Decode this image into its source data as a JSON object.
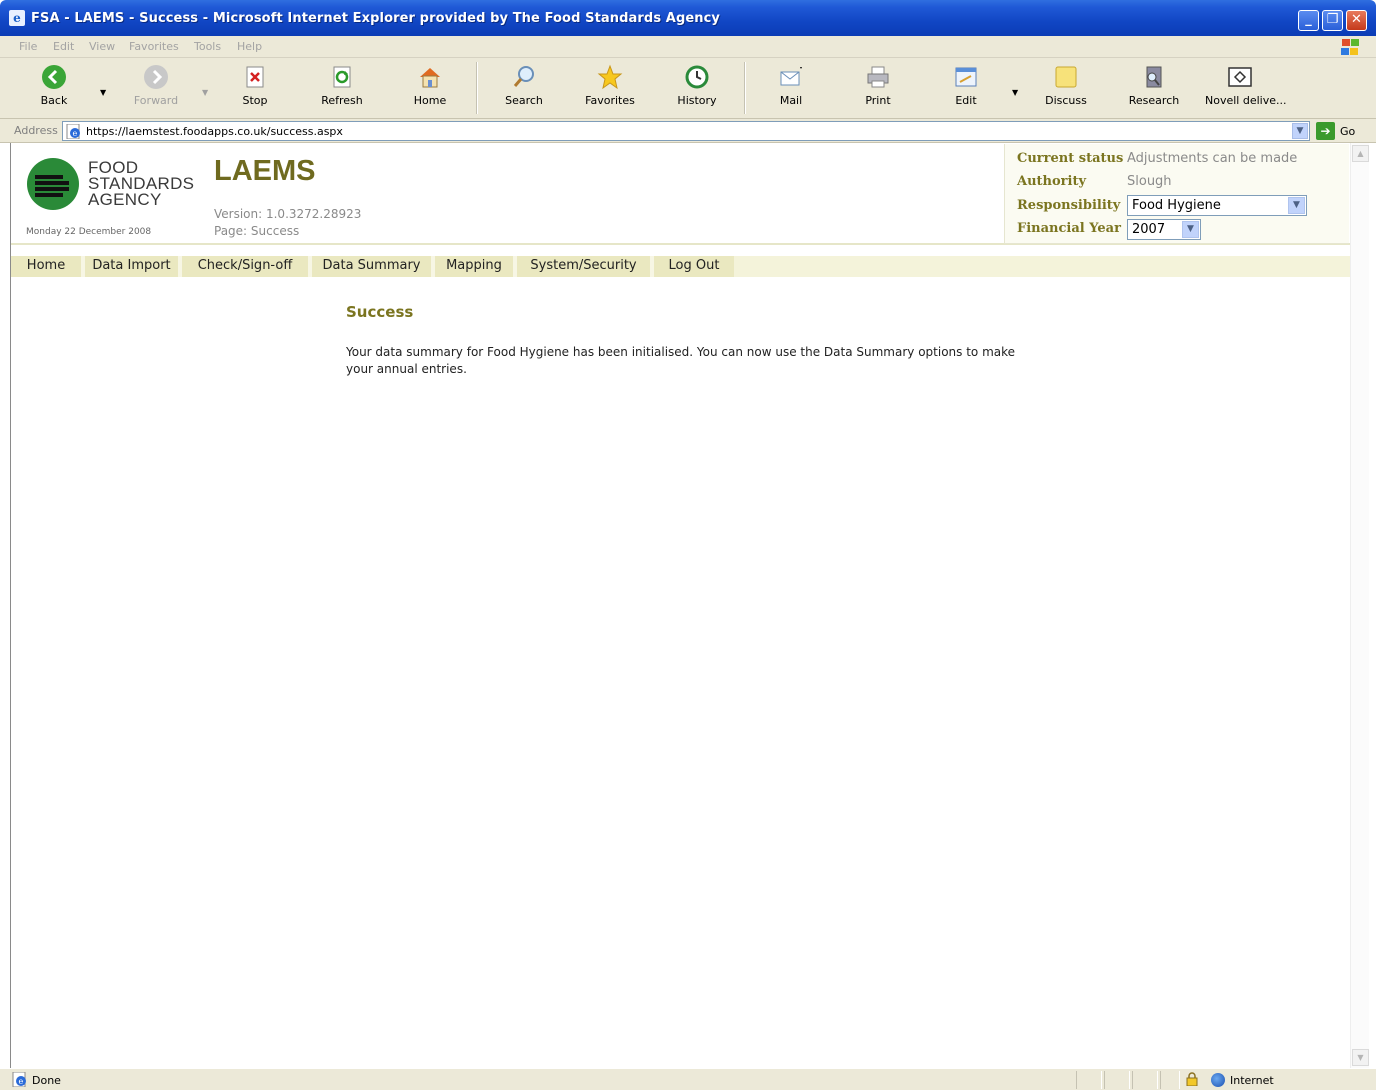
{
  "window": {
    "title": "FSA - LAEMS - Success - Microsoft Internet Explorer provided by The Food Standards Agency",
    "minimize": "_",
    "restore": "❐",
    "close": "✕"
  },
  "menu": [
    "File",
    "Edit",
    "View",
    "Favorites",
    "Tools",
    "Help"
  ],
  "toolbar": {
    "back": "Back",
    "forward": "Forward",
    "stop": "Stop",
    "refresh": "Refresh",
    "home": "Home",
    "search": "Search",
    "favorites": "Favorites",
    "history": "History",
    "mail": "Mail",
    "print": "Print",
    "edit": "Edit",
    "discuss": "Discuss",
    "research": "Research",
    "novell": "Novell delive..."
  },
  "address": {
    "label": "Address",
    "url": "https://laemstest.foodapps.co.uk/success.aspx",
    "go": "Go"
  },
  "header": {
    "logo_lines": [
      "FOOD",
      "STANDARDS",
      "AGENCY"
    ],
    "date": "Monday 22 December 2008",
    "app_name": "LAEMS",
    "version": "Version: 1.0.3272.28923",
    "page": "Page: Success"
  },
  "status_panel": {
    "current_status_label": "Current status",
    "current_status_value": "Adjustments can be made",
    "authority_label": "Authority",
    "authority_value": "Slough",
    "responsibility_label": "Responsibility",
    "responsibility_value": "Food Hygiene",
    "financial_year_label": "Financial Year",
    "financial_year_value": "2007"
  },
  "nav": [
    "Home",
    "Data Import",
    "Check/Sign-off",
    "Data Summary",
    "Mapping",
    "System/Security",
    "Log Out"
  ],
  "content": {
    "heading": "Success",
    "message": "Your data summary for Food Hygiene has been initialised. You can now use the Data Summary options to make your annual entries."
  },
  "statusbar": {
    "text": "Done",
    "zone": "Internet"
  }
}
